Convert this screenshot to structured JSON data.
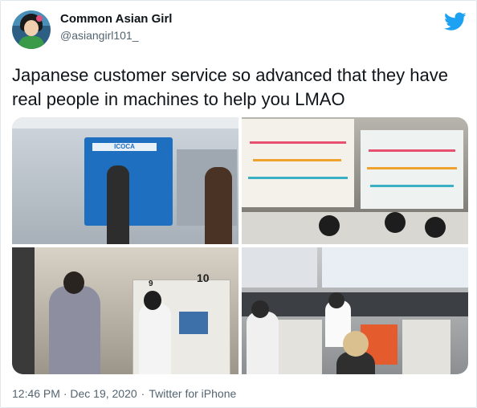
{
  "tweet": {
    "author_name": "Common Asian Girl",
    "author_handle": "@asiangirl101_",
    "text": "Japanese customer service so advanced that they have real people in machines to help you LMAO",
    "timestamp": "12:46 PM · Dec 19, 2020",
    "source": "Twitter for iPhone",
    "brand_icon": "twitter-bird-icon",
    "brand_color": "#1da1f2"
  },
  "media": {
    "photo_count": 4,
    "sign_numbers": [
      "9",
      "10"
    ],
    "sign_labels": [
      "ICOCA"
    ]
  }
}
